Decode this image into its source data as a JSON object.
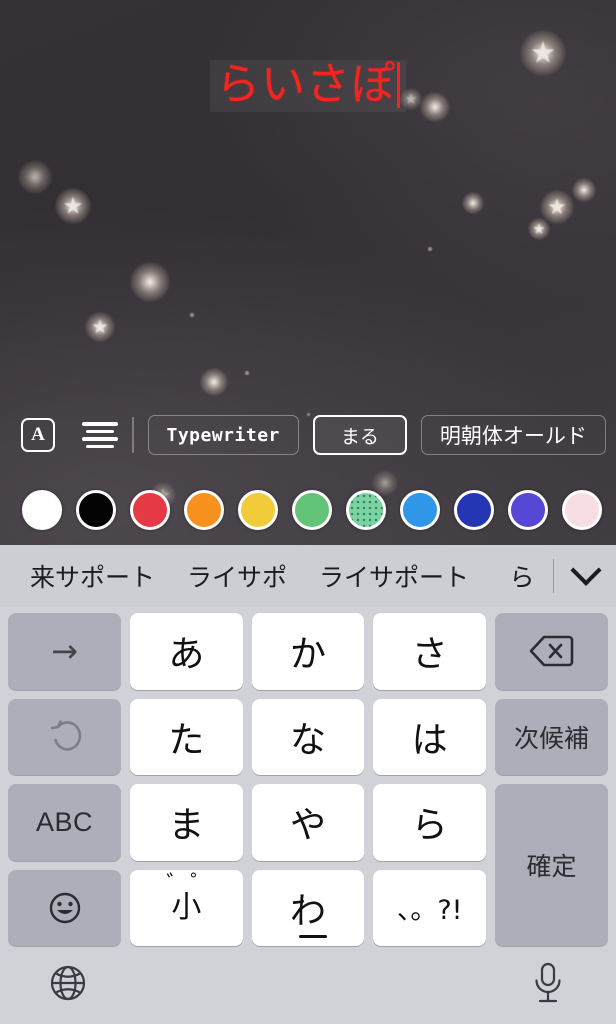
{
  "canvas": {
    "text_object": {
      "value": "らいさぽ",
      "color": "#f4241f",
      "caret_visible": true
    }
  },
  "toolbar": {
    "text_style_icon_label": "A",
    "align_icon_name": "text-align-center",
    "fonts": [
      {
        "label": "Typewriter",
        "style": "mono",
        "selected": false
      },
      {
        "label": "まる",
        "style": "round",
        "selected": true
      },
      {
        "label": "明朝体オールド",
        "style": "serif",
        "selected": false
      }
    ]
  },
  "colors": {
    "swatches": [
      {
        "name": "white",
        "hex": "#ffffff",
        "pattern": false
      },
      {
        "name": "black",
        "hex": "#040404",
        "pattern": false
      },
      {
        "name": "red",
        "hex": "#e63946",
        "pattern": false
      },
      {
        "name": "orange",
        "hex": "#f7921e",
        "pattern": false
      },
      {
        "name": "yellow",
        "hex": "#f2cb3a",
        "pattern": false
      },
      {
        "name": "green",
        "hex": "#63c479",
        "pattern": false
      },
      {
        "name": "green-dotted",
        "hex": "#7fd2a0",
        "pattern": true
      },
      {
        "name": "blue",
        "hex": "#2f96e8",
        "pattern": false
      },
      {
        "name": "navy",
        "hex": "#2436b4",
        "pattern": false
      },
      {
        "name": "violet",
        "hex": "#5647d4",
        "pattern": false
      },
      {
        "name": "pink",
        "hex": "#f7dee4",
        "pattern": false
      }
    ]
  },
  "keyboard": {
    "suggestions": [
      "来サポート",
      "ライサポ",
      "ライサポート",
      "ら"
    ],
    "expand_icon": "chevron-down-icon",
    "keys": {
      "row1": [
        {
          "name": "cursor-right-key",
          "label": "→",
          "type": "fn-arrow"
        },
        {
          "name": "key-a",
          "label": "あ",
          "type": "char"
        },
        {
          "name": "key-ka",
          "label": "か",
          "type": "char"
        },
        {
          "name": "key-sa",
          "label": "さ",
          "type": "char"
        },
        {
          "name": "delete-key",
          "label": "⌫",
          "type": "fn-delete"
        }
      ],
      "row2": [
        {
          "name": "undo-key",
          "label": "↺",
          "type": "fn-undo"
        },
        {
          "name": "key-ta",
          "label": "た",
          "type": "char"
        },
        {
          "name": "key-na",
          "label": "な",
          "type": "char"
        },
        {
          "name": "key-ha",
          "label": "は",
          "type": "char"
        },
        {
          "name": "next-candidate-key",
          "label": "次候補",
          "type": "fn-text"
        }
      ],
      "row3": [
        {
          "name": "abc-mode-key",
          "label": "ABC",
          "type": "fn-abc"
        },
        {
          "name": "key-ma",
          "label": "ま",
          "type": "char"
        },
        {
          "name": "key-ya",
          "label": "や",
          "type": "char"
        },
        {
          "name": "key-ra",
          "label": "ら",
          "type": "char"
        },
        {
          "name": "confirm-key",
          "label": "確定",
          "type": "fn-text-tall"
        }
      ],
      "row4": [
        {
          "name": "emoji-key",
          "label": "☺",
          "type": "fn-emoji"
        },
        {
          "name": "small-dakuten-key",
          "label": "小",
          "marks": "゛゜",
          "type": "char-kogaki"
        },
        {
          "name": "key-wa",
          "label": "わ",
          "type": "char-wa"
        },
        {
          "name": "punctuation-key",
          "label": "、。?!",
          "type": "char-mini"
        }
      ]
    },
    "bottom_bar": {
      "globe_icon": "globe-icon",
      "mic_icon": "microphone-icon"
    }
  }
}
